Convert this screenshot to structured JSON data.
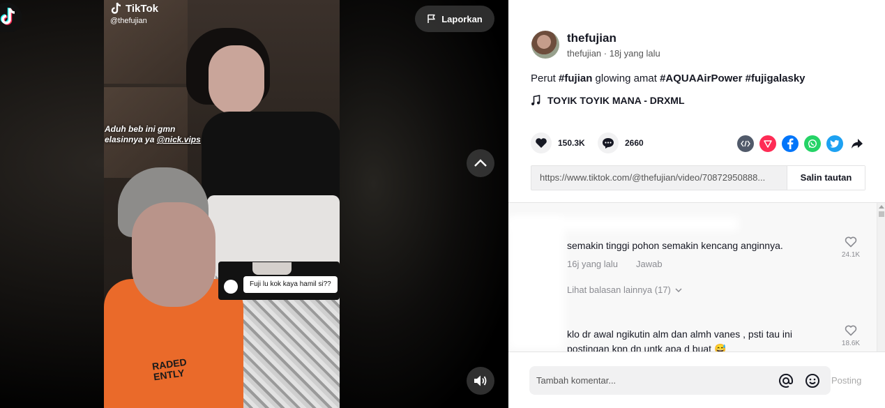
{
  "video": {
    "watermark_brand": "TikTok",
    "watermark_handle": "@thefujian",
    "overlay_caption_line1": "Aduh beb ini gmn",
    "overlay_caption_line2_prefix": "elasinnya ya ",
    "overlay_caption_mention": "@nick.vips",
    "reply_sticker_text": "Fuji lu kok kaya hamil si??",
    "shirt_text_line1": "RADED",
    "shirt_text_line2": "ENTLY",
    "report_label": "Laporkan"
  },
  "author": {
    "name": "thefujian",
    "handle": "thefujian",
    "time": "18j yang lalu"
  },
  "post": {
    "desc_prefix": "Perut ",
    "tag_fujian": "#fujian",
    "desc_middle": " glowing amat ",
    "tag_aqua": "#AQUAAirPower",
    "tag_fujigalasky": "#fujigalasky",
    "music": "TOYIK TOYIK MANA - DRXML",
    "likes": "150.3K",
    "comments": "2660",
    "link": "https://www.tiktok.com/@thefujian/video/70872950888...",
    "copy_label": "Salin tautan"
  },
  "comments": [
    {
      "text": "semakin tinggi pohon semakin kencang anginnya.",
      "time": "16j yang lalu",
      "reply_label": "Jawab",
      "likes": "24.1K",
      "more_replies": "Lihat balasan lainnya (17)"
    },
    {
      "text": "klo dr awal ngikutin alm dan almh vanes , psti tau ini",
      "text_line2": "postingan kpn dn untk apa d buat 😅",
      "likes": "18.6K"
    }
  ],
  "input": {
    "placeholder": "Tambah komentar...",
    "post_label": "Posting"
  },
  "colors": {
    "accent": "#fe2c55",
    "facebook": "#0075fa",
    "whatsapp": "#25d366",
    "twitter": "#1da1f2",
    "embed": "#515a6a"
  }
}
